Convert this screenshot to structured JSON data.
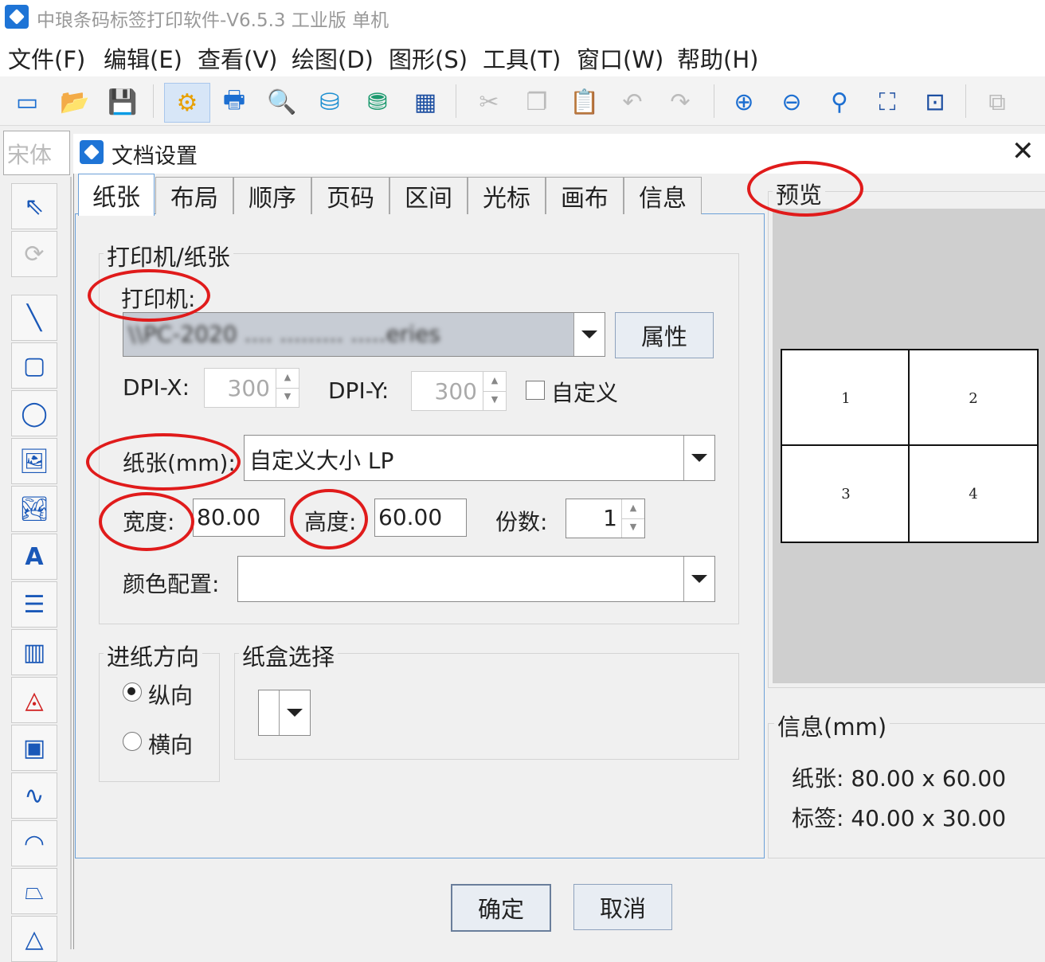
{
  "app": {
    "title": "中琅条码标签打印软件-V6.5.3 工业版 单机"
  },
  "menu": [
    "文件(F)",
    "编辑(E)",
    "查看(V)",
    "绘图(D)",
    "图形(S)",
    "工具(T)",
    "窗口(W)",
    "帮助(H)"
  ],
  "toolbar": [
    {
      "name": "new-icon",
      "glyph": "▭"
    },
    {
      "name": "open-icon",
      "glyph": "📂"
    },
    {
      "name": "save-icon",
      "glyph": "💾"
    },
    {
      "name": "doc-settings-icon",
      "glyph": "⚙"
    },
    {
      "name": "print-icon",
      "glyph": "🖶"
    },
    {
      "name": "print-preview-icon",
      "glyph": "🔍"
    },
    {
      "name": "database-icon",
      "glyph": "⛁"
    },
    {
      "name": "database-refresh-icon",
      "glyph": "⛃"
    },
    {
      "name": "grid-icon",
      "glyph": "▦"
    },
    {
      "name": "cut-icon",
      "glyph": "✂"
    },
    {
      "name": "copy-icon",
      "glyph": "❐"
    },
    {
      "name": "paste-icon",
      "glyph": "📋"
    },
    {
      "name": "undo-icon",
      "glyph": "↶"
    },
    {
      "name": "redo-icon",
      "glyph": "↷"
    },
    {
      "name": "zoom-in-icon",
      "glyph": "⊕"
    },
    {
      "name": "zoom-out-icon",
      "glyph": "⊖"
    },
    {
      "name": "zoom-icon",
      "glyph": "⚲"
    },
    {
      "name": "fit-page-icon",
      "glyph": "⛶"
    },
    {
      "name": "fit-window-icon",
      "glyph": "⊡"
    },
    {
      "name": "align-icon",
      "glyph": "⧉"
    }
  ],
  "font_box": "宋体",
  "left_tools": [
    {
      "name": "select-tool-icon",
      "glyph": "⇖"
    },
    {
      "name": "rotate-tool-icon",
      "glyph": "⟳"
    },
    {
      "name": "line-tool-icon",
      "glyph": "╲"
    },
    {
      "name": "rect-tool-icon",
      "glyph": "▢"
    },
    {
      "name": "ellipse-tool-icon",
      "glyph": "◯"
    },
    {
      "name": "image-tool-icon",
      "glyph": "🖼"
    },
    {
      "name": "image2-tool-icon",
      "glyph": "🏞"
    },
    {
      "name": "text-tool-icon",
      "glyph": "A"
    },
    {
      "name": "rich-text-tool-icon",
      "glyph": "☰"
    },
    {
      "name": "barcode-tool-icon",
      "glyph": "▥"
    },
    {
      "name": "polygon-tool-icon",
      "glyph": "◬"
    },
    {
      "name": "qrcode-tool-icon",
      "glyph": "▣"
    },
    {
      "name": "curve-tool-icon",
      "glyph": "∿"
    },
    {
      "name": "arc-tool-icon",
      "glyph": "◠"
    },
    {
      "name": "free-shape-tool-icon",
      "glyph": "⏢"
    },
    {
      "name": "triangle-tool-icon",
      "glyph": "△"
    }
  ],
  "dialog": {
    "title": "文档设置",
    "close_glyph": "✕",
    "tabs": [
      "纸张",
      "布局",
      "顺序",
      "页码",
      "区间",
      "光标",
      "画布",
      "信息"
    ],
    "printer_group": {
      "label": "打印机/纸张",
      "printer_label": "打印机:",
      "printer_value": "\\\\PC-2020 .... ......... .....eries",
      "properties_button": "属性",
      "dpix_label": "DPI-X:",
      "dpix_value": "300",
      "dpiy_label": "DPI-Y:",
      "dpiy_value": "300",
      "custom_label": "自定义",
      "paper_label": "纸张(mm):",
      "paper_value": "自定义大小 LP",
      "width_label": "宽度:",
      "width_value": "80.00",
      "height_label": "高度:",
      "height_value": "60.00",
      "copies_label": "份数:",
      "copies_value": "1",
      "color_label": "颜色配置:",
      "color_value": ""
    },
    "feed_group": {
      "label": "进纸方向",
      "portrait": "纵向",
      "landscape": "横向",
      "selected": "纵向"
    },
    "tray_group": {
      "label": "纸盒选择"
    },
    "preview": {
      "label": "预览",
      "cells": [
        "1",
        "2",
        "3",
        "4"
      ]
    },
    "info": {
      "label": "信息(mm)",
      "paper_label": "纸张:",
      "paper_value": "80.00 x 60.00",
      "label_label": "标签:",
      "label_value": "40.00 x 30.00"
    },
    "ok_button": "确定",
    "cancel_button": "取消"
  },
  "annotation_color": "#e01b1b"
}
